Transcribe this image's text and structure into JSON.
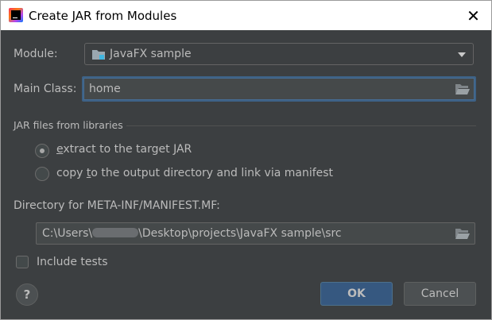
{
  "window": {
    "title": "Create JAR from Modules",
    "close_symbol": "✕"
  },
  "module": {
    "label": "Module:",
    "value": "JavaFX sample"
  },
  "main_class": {
    "label": "Main Class:",
    "value": "home"
  },
  "libraries": {
    "title": "JAR files from libraries",
    "options": [
      {
        "mnemonic": "e",
        "rest": "xtract to the target JAR",
        "selected": true
      },
      {
        "prefix": "copy ",
        "mnemonic": "t",
        "rest": "o the output directory and link via manifest",
        "selected": false
      }
    ]
  },
  "manifest": {
    "label": "Directory for META-INF/MANIFEST.MF:",
    "path_prefix": "C:\\Users\\",
    "path_suffix": "\\Desktop\\projects\\JavaFX sample\\src"
  },
  "include_tests": {
    "label": "Include tests",
    "checked": false
  },
  "buttons": {
    "help": "?",
    "ok": "OK",
    "cancel": "Cancel"
  },
  "colors": {
    "accent": "#365880",
    "focus_border": "#3d6185",
    "background": "#3c3f41"
  }
}
